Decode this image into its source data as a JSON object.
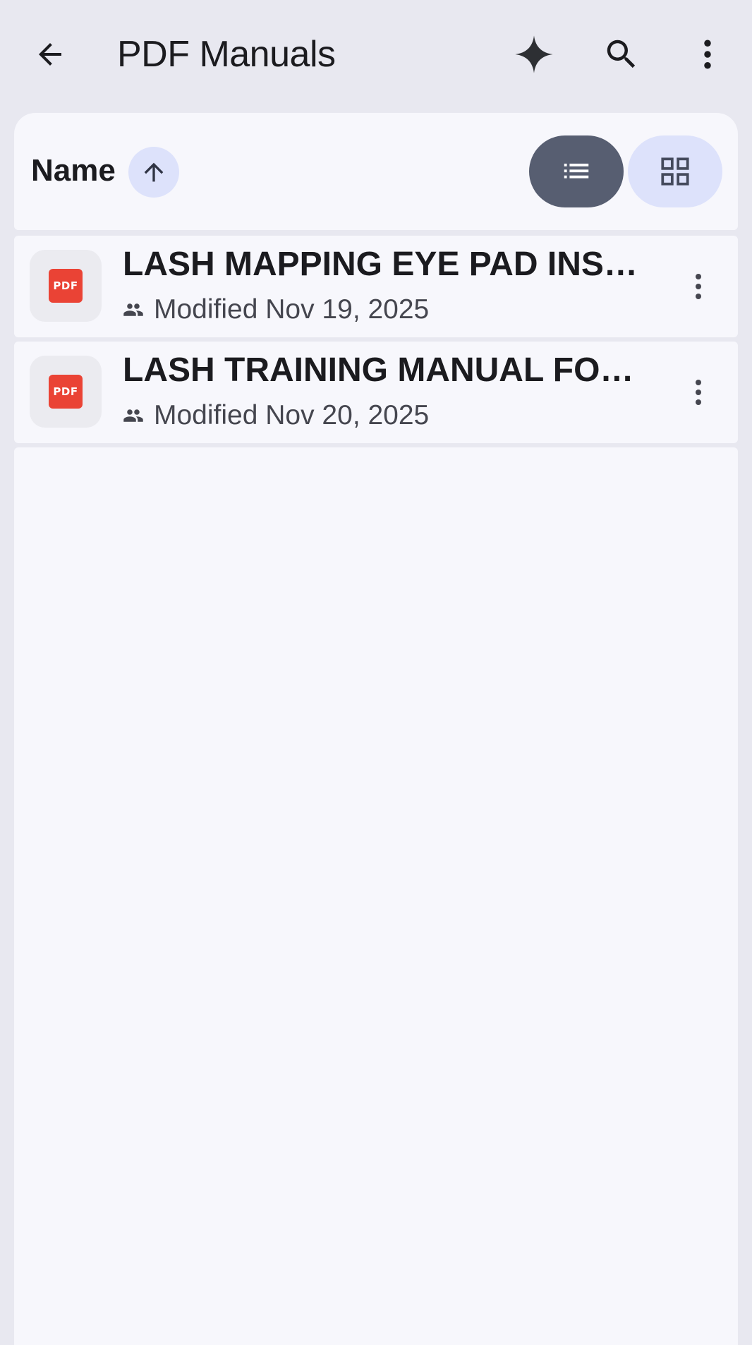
{
  "header": {
    "title": "PDF Manuals",
    "back_icon": "arrow-left-icon",
    "actions": [
      "sparkle-icon",
      "search-icon",
      "more-vert-icon"
    ]
  },
  "sort": {
    "label": "Name",
    "direction": "ascending",
    "direction_icon": "arrow-up-icon"
  },
  "view_toggle": {
    "selected": "list",
    "options": [
      "list-view-icon",
      "grid-view-icon"
    ]
  },
  "files": [
    {
      "name": "LASH MAPPING EYE PAD INS…",
      "meta": "Modified Nov 19, 2025",
      "shared": true,
      "type_label": "PDF"
    },
    {
      "name": "LASH TRAINING MANUAL FO…",
      "meta": "Modified Nov 20, 2025",
      "shared": true,
      "type_label": "PDF"
    }
  ],
  "colors": {
    "header_bg": "#e8e8f0",
    "surface": "#f7f7fc",
    "list_toggle_selected": "#575e71",
    "toggle_unselected": "#dde2fb",
    "pdf_red": "#ea4335"
  }
}
